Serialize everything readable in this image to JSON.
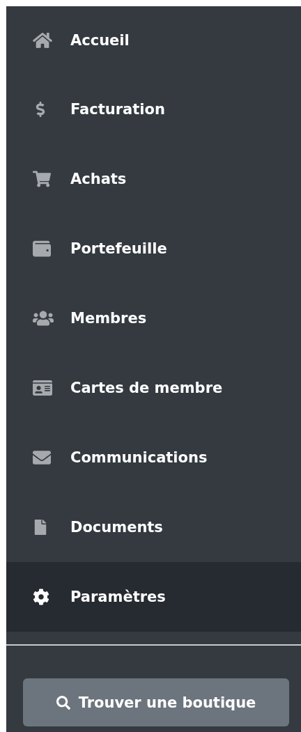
{
  "sidebar": {
    "items": [
      {
        "label": "Accueil",
        "selected": false
      },
      {
        "label": "Facturation",
        "selected": false
      },
      {
        "label": "Achats",
        "selected": false
      },
      {
        "label": "Portefeuille",
        "selected": false
      },
      {
        "label": "Membres",
        "selected": false
      },
      {
        "label": "Cartes de membre",
        "selected": false
      },
      {
        "label": "Communications",
        "selected": false
      },
      {
        "label": "Documents",
        "selected": false
      },
      {
        "label": "Paramètres",
        "selected": true
      }
    ],
    "find_button": {
      "label": "Trouver une boutique"
    }
  }
}
